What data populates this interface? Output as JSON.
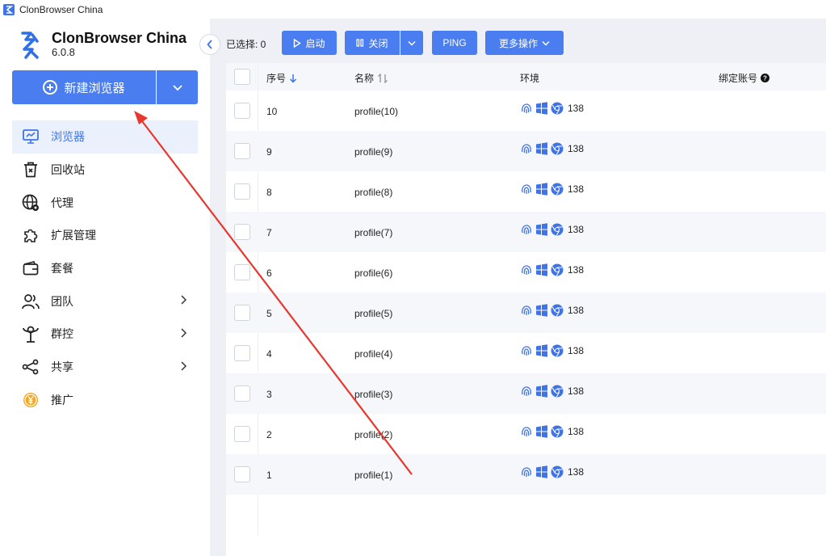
{
  "window": {
    "title": "ClonBrowser China"
  },
  "brand": {
    "name": "ClonBrowser China",
    "version": "6.0.8"
  },
  "new_button": {
    "label": "新建浏览器"
  },
  "nav": {
    "items": [
      {
        "label": "浏览器",
        "icon": "monitor-icon"
      },
      {
        "label": "回收站",
        "icon": "trash-icon"
      },
      {
        "label": "代理",
        "icon": "globe-gear-icon"
      },
      {
        "label": "扩展管理",
        "icon": "puzzle-icon"
      },
      {
        "label": "套餐",
        "icon": "wallet-icon"
      },
      {
        "label": "团队",
        "icon": "team-icon"
      },
      {
        "label": "群控",
        "icon": "group-control-icon"
      },
      {
        "label": "共享",
        "icon": "share-icon"
      },
      {
        "label": "推广",
        "icon": "yuan-icon"
      }
    ]
  },
  "toolbar": {
    "selected_label": "已选择: 0",
    "start": "启动",
    "close": "关闭",
    "ping": "PING",
    "more": "更多操作"
  },
  "table": {
    "headers": {
      "index": "序号",
      "name": "名称",
      "env": "环境",
      "account": "绑定账号"
    },
    "rows": [
      {
        "index": "10",
        "name": "profile(10)",
        "env_version": "138"
      },
      {
        "index": "9",
        "name": "profile(9)",
        "env_version": "138"
      },
      {
        "index": "8",
        "name": "profile(8)",
        "env_version": "138"
      },
      {
        "index": "7",
        "name": "profile(7)",
        "env_version": "138"
      },
      {
        "index": "6",
        "name": "profile(6)",
        "env_version": "138"
      },
      {
        "index": "5",
        "name": "profile(5)",
        "env_version": "138"
      },
      {
        "index": "4",
        "name": "profile(4)",
        "env_version": "138"
      },
      {
        "index": "3",
        "name": "profile(3)",
        "env_version": "138"
      },
      {
        "index": "2",
        "name": "profile(2)",
        "env_version": "138"
      },
      {
        "index": "1",
        "name": "profile(1)",
        "env_version": "138"
      }
    ]
  },
  "colors": {
    "accent": "#4a7ef0",
    "active_bg": "#eaf1fd",
    "annotation_arrow": "#e8372d"
  }
}
